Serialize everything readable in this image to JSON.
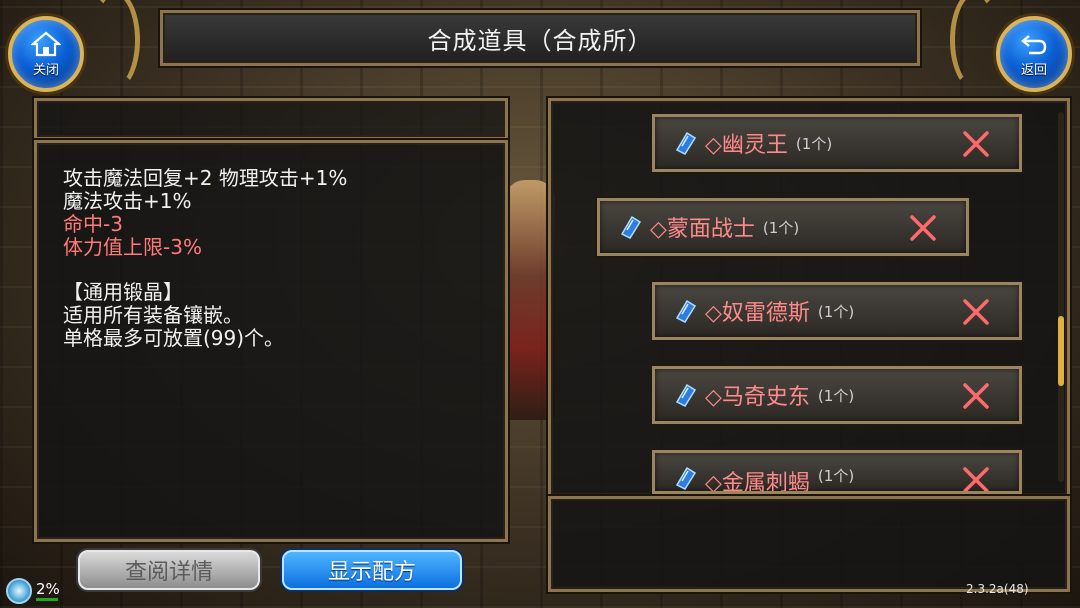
{
  "title": "合成道具（合成所）",
  "nav": {
    "close_label": "关闭",
    "back_label": "返回"
  },
  "description": {
    "lines": [
      "攻击魔法回复+2 物理攻击+1%",
      "魔法攻击+1%"
    ],
    "red_lines": [
      "命中-3",
      "体力值上限-3%"
    ],
    "notes": [
      "【通用锻晶】",
      "适用所有装备镶嵌。",
      "单格最多可放置(99)个。"
    ]
  },
  "items": [
    {
      "name": "◇幽灵王",
      "qty": "(1个)"
    },
    {
      "name": "◇蒙面战士",
      "qty": "(1个)"
    },
    {
      "name": "◇奴雷德斯",
      "qty": "(1个)"
    },
    {
      "name": "◇马奇史东",
      "qty": "(1个)"
    },
    {
      "name": "◇金属刺蝎",
      "qty": "(1个)"
    }
  ],
  "buttons": {
    "detail": "查阅详情",
    "recipe": "显示配方"
  },
  "status": {
    "percent": "2%",
    "version": "2.3.2a(48)"
  },
  "colors": {
    "accent_blue": "#0b6fe0",
    "item_name_red": "#ff8a8a",
    "frame_gold": "#8a7550"
  }
}
